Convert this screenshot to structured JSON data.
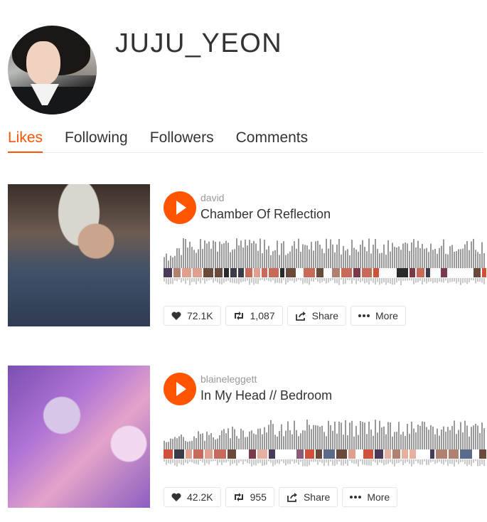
{
  "profile": {
    "username": "JUJU_YEON"
  },
  "tabs": [
    {
      "label": "Likes",
      "active": true
    },
    {
      "label": "Following",
      "active": false
    },
    {
      "label": "Followers",
      "active": false
    },
    {
      "label": "Comments",
      "active": false
    }
  ],
  "tracks": [
    {
      "uploader": "david",
      "title": "Chamber Of Reflection",
      "likes": "72.1K",
      "reposts": "1,087",
      "share_label": "Share",
      "more_label": "More"
    },
    {
      "uploader": "blaineleggett",
      "title": "In My Head // Bedroom",
      "likes": "42.2K",
      "reposts": "955",
      "share_label": "Share",
      "more_label": "More"
    }
  ],
  "colors": {
    "accent": "#ff5500",
    "waveform": "#999999",
    "text": "#333333",
    "muted": "#999999"
  },
  "icons": {
    "play": "play-icon",
    "like": "heart-icon",
    "repost": "repost-icon",
    "share": "share-icon",
    "more": "more-icon"
  }
}
